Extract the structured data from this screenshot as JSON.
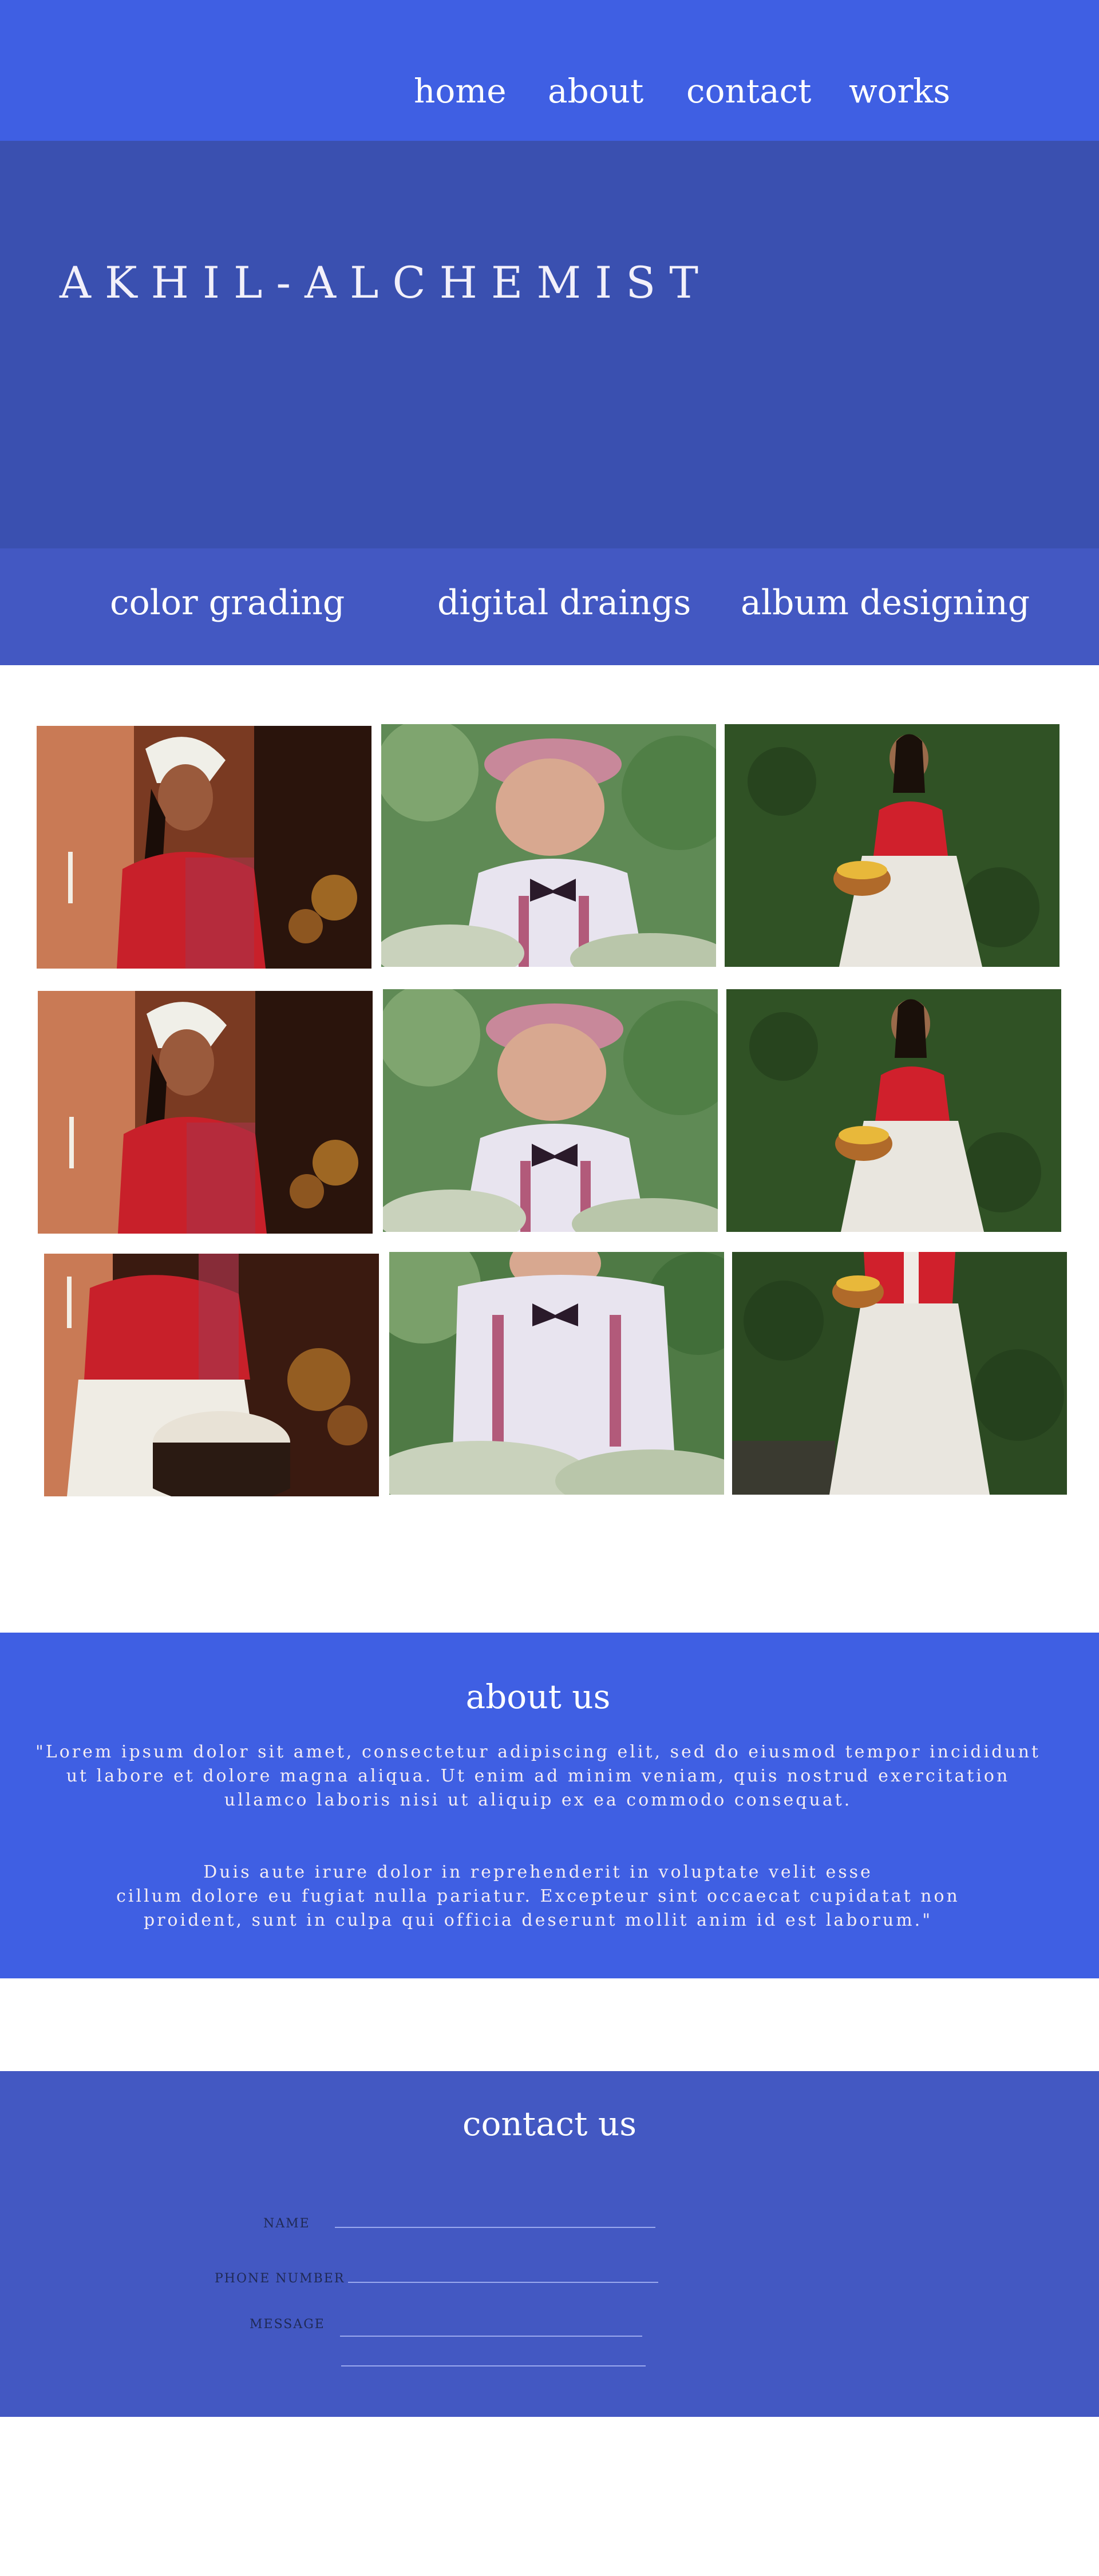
{
  "nav": {
    "links": [
      {
        "label": "home"
      },
      {
        "label": "about"
      },
      {
        "label": "contact"
      },
      {
        "label": "works"
      }
    ]
  },
  "hero": {
    "brand": "AKHIL-ALCHEMIST"
  },
  "services": {
    "items": [
      {
        "label": "color grading"
      },
      {
        "label": "digital draings"
      },
      {
        "label": "album designing"
      }
    ]
  },
  "gallery": {
    "rows": 3,
    "columns": 3,
    "photos": [
      {
        "subject": "woman in red blouse with white head wrap"
      },
      {
        "subject": "baby in cap and bow tie"
      },
      {
        "subject": "woman in red and white holding basket"
      },
      {
        "subject": "woman in red blouse with white head wrap"
      },
      {
        "subject": "baby in cap and bow tie"
      },
      {
        "subject": "woman in red and white holding basket"
      },
      {
        "subject": "woman playing drum"
      },
      {
        "subject": "baby in cap and bow tie"
      },
      {
        "subject": "woman in red and white holding basket"
      }
    ]
  },
  "about": {
    "title": "about us",
    "paragraph_1": "\"Lorem ipsum dolor sit amet, consectetur adipiscing elit, sed do eiusmod tempor incididunt\nut labore et dolore magna aliqua. Ut enim ad minim veniam, quis nostrud exercitation\nullamco laboris nisi ut aliquip ex ea commodo consequat.",
    "paragraph_2": "Duis aute irure dolor in reprehenderit in voluptate velit esse\ncillum dolore eu fugiat nulla pariatur. Excepteur sint occaecat cupidatat non\nproident, sunt in culpa qui officia deserunt mollit anim id est laborum.\""
  },
  "contact": {
    "title": "contact us",
    "fields": {
      "name_label": "NAME",
      "phone_label": "PHONE NUMBER",
      "message_label": "MESSAGE"
    }
  },
  "colors": {
    "nav_bg": "#3f5fe3",
    "hero_bg": "#3a50b0",
    "services_bg": "#4358c2",
    "about_bg": "#3f5fe3",
    "contact_bg": "#4358c2"
  }
}
